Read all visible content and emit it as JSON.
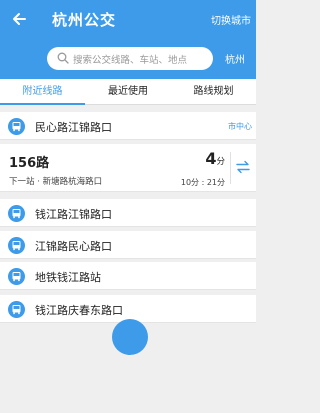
{
  "header": {
    "title": "杭州公交",
    "switch_city_label": "切换城市",
    "search_placeholder": "搜索公交线路、车站、地点",
    "city": "杭州"
  },
  "tabs": [
    {
      "label": "附近线路",
      "active": true
    },
    {
      "label": "最近使用",
      "active": false
    },
    {
      "label": "路线规划",
      "active": false
    }
  ],
  "nearby": {
    "primary_stop": {
      "name": "民心路江锦路口",
      "tag": "市中心"
    },
    "route": {
      "name": "156路",
      "next_stop": "下一站 · 新塘路杭海路口",
      "eta_value": "4",
      "eta_unit": "分",
      "time_range": "10分 : 21分"
    },
    "stops": [
      {
        "name": "钱江路江锦路口"
      },
      {
        "name": "江锦路民心路口"
      },
      {
        "name": "地铁钱江路站"
      },
      {
        "name": "钱江路庆春东路口"
      }
    ]
  },
  "colors": {
    "accent": "#3d9be9",
    "background": "#efefef"
  },
  "icons": [
    "back-arrow-icon",
    "search-icon",
    "bus-stop-icon",
    "swap-icon"
  ]
}
